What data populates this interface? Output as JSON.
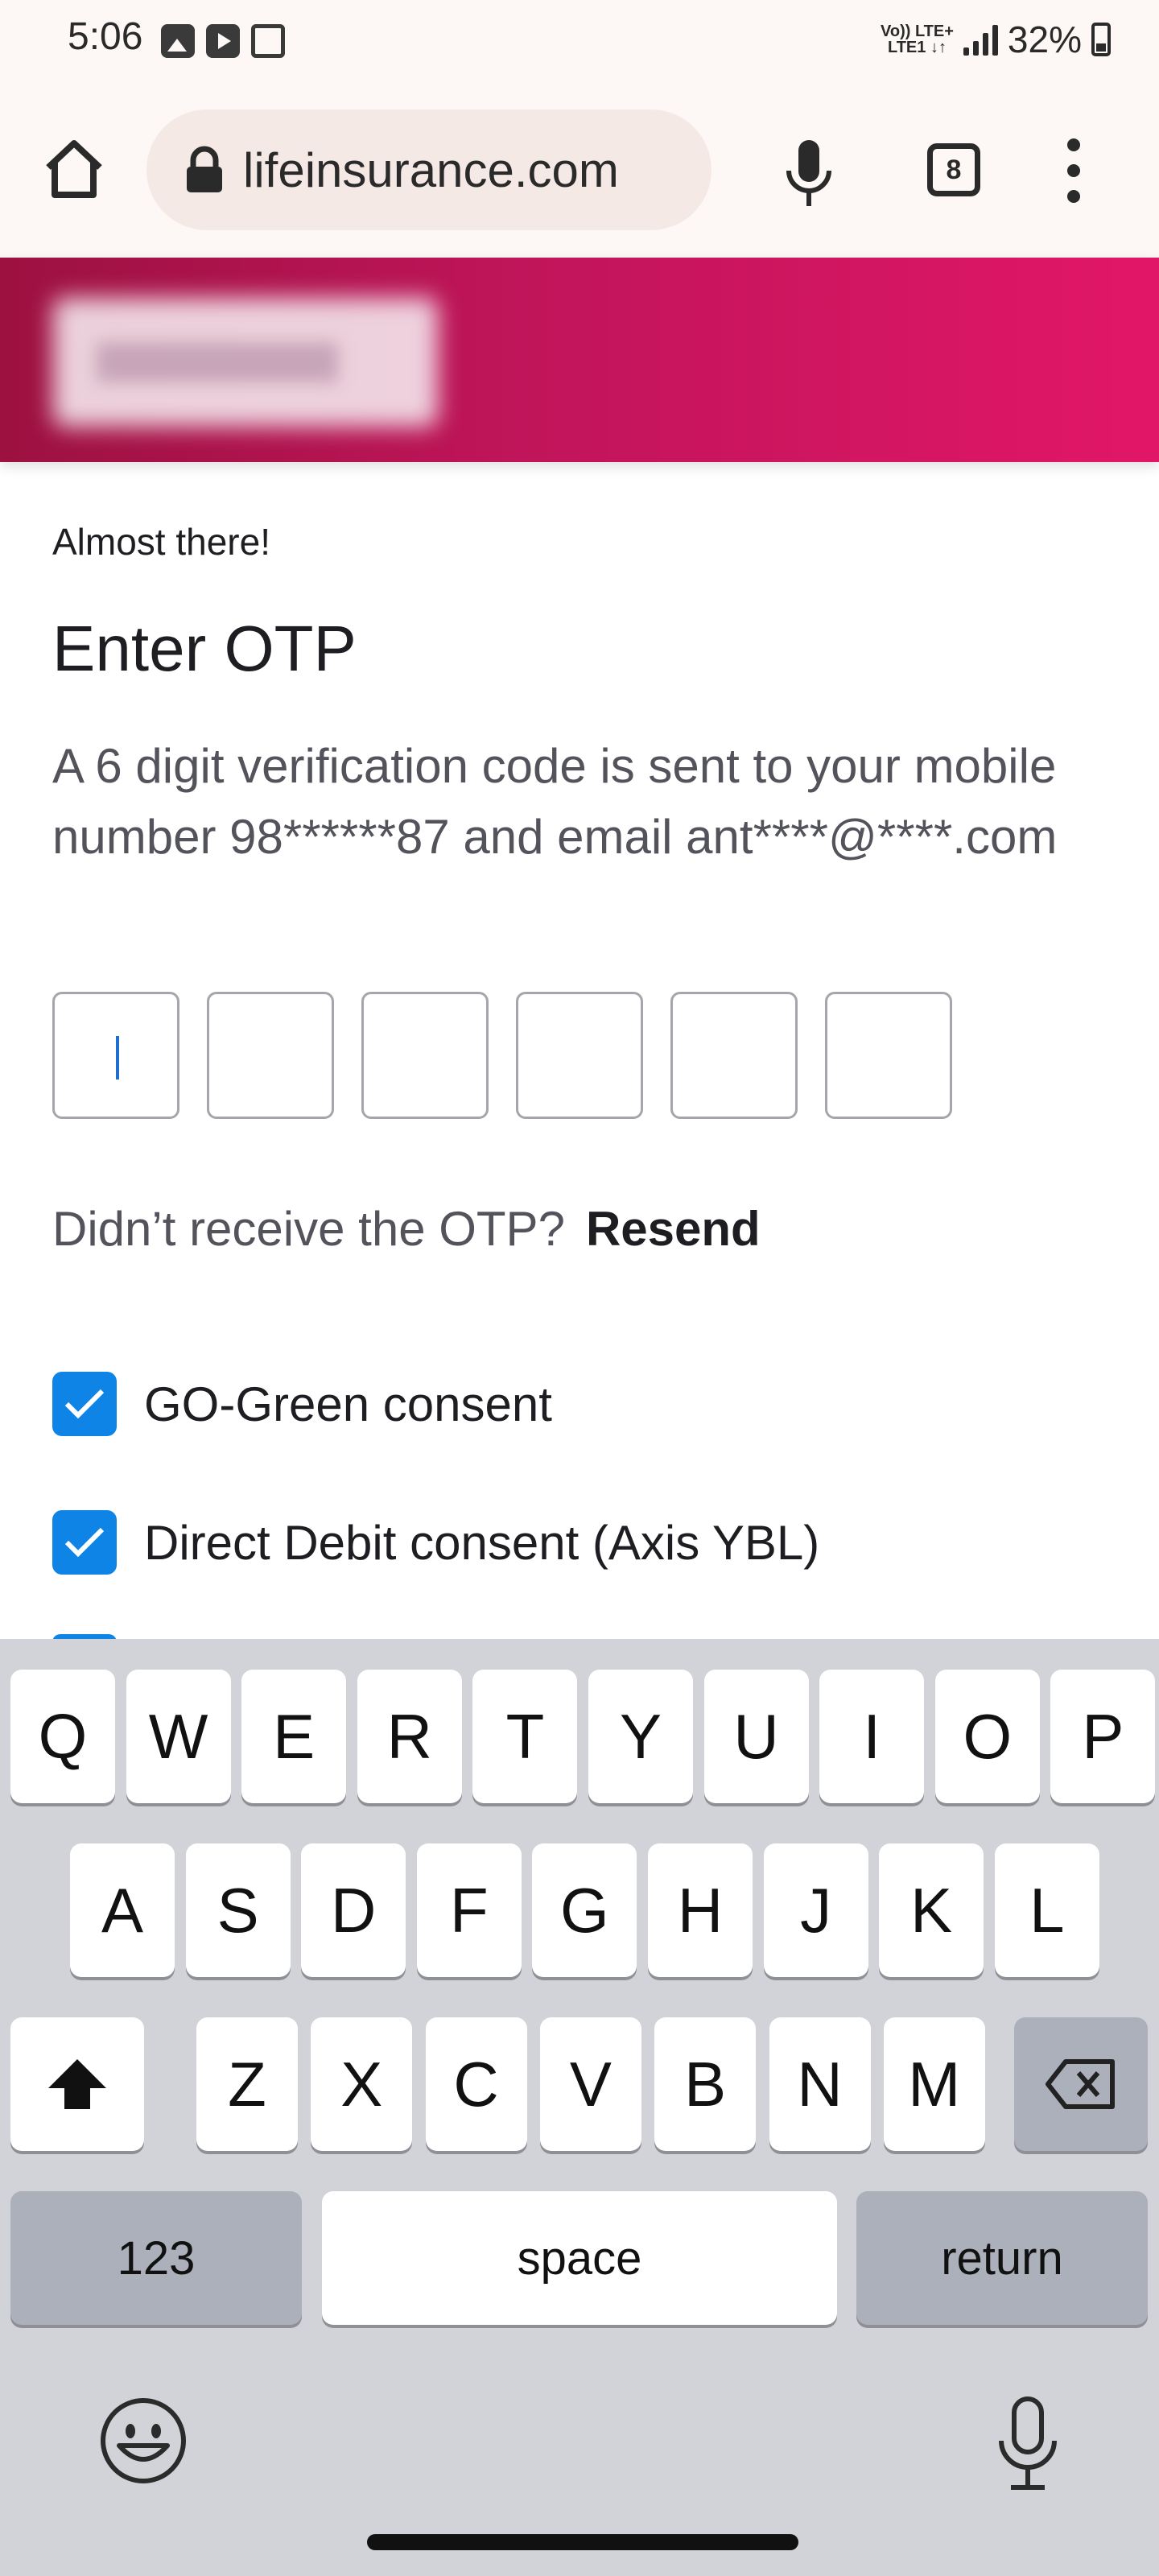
{
  "status_bar": {
    "time": "5:06",
    "network_line1": "Vo)) LTE+",
    "network_line2": "LTE1 ↓↑",
    "battery_percent": "32%"
  },
  "browser": {
    "url": "lifeinsurance.com",
    "tab_count": "8"
  },
  "page": {
    "subtitle": "Almost there!",
    "title": "Enter OTP",
    "description": "A 6 digit verification code is sent to your mobile number 98******87 and email ant****@****.com",
    "otp_digits": [
      "",
      "",
      "",
      "",
      "",
      ""
    ],
    "resend_prompt": "Didn’t receive the OTP?",
    "resend_link": "Resend",
    "consents": [
      {
        "label": "GO-Green consent",
        "checked": true
      },
      {
        "label": "Direct Debit consent (Axis YBL)",
        "checked": true
      }
    ]
  },
  "keyboard": {
    "row1": [
      "Q",
      "W",
      "E",
      "R",
      "T",
      "Y",
      "U",
      "I",
      "O",
      "P"
    ],
    "row2": [
      "A",
      "S",
      "D",
      "F",
      "G",
      "H",
      "J",
      "K",
      "L"
    ],
    "row3": [
      "Z",
      "X",
      "C",
      "V",
      "B",
      "N",
      "M"
    ],
    "numbers_label": "123",
    "space_label": "space",
    "return_label": "return"
  },
  "colors": {
    "header_pink": "#e21667",
    "checkbox_blue": "#0e84e6",
    "keyboard_bg": "#d2d3d8"
  }
}
